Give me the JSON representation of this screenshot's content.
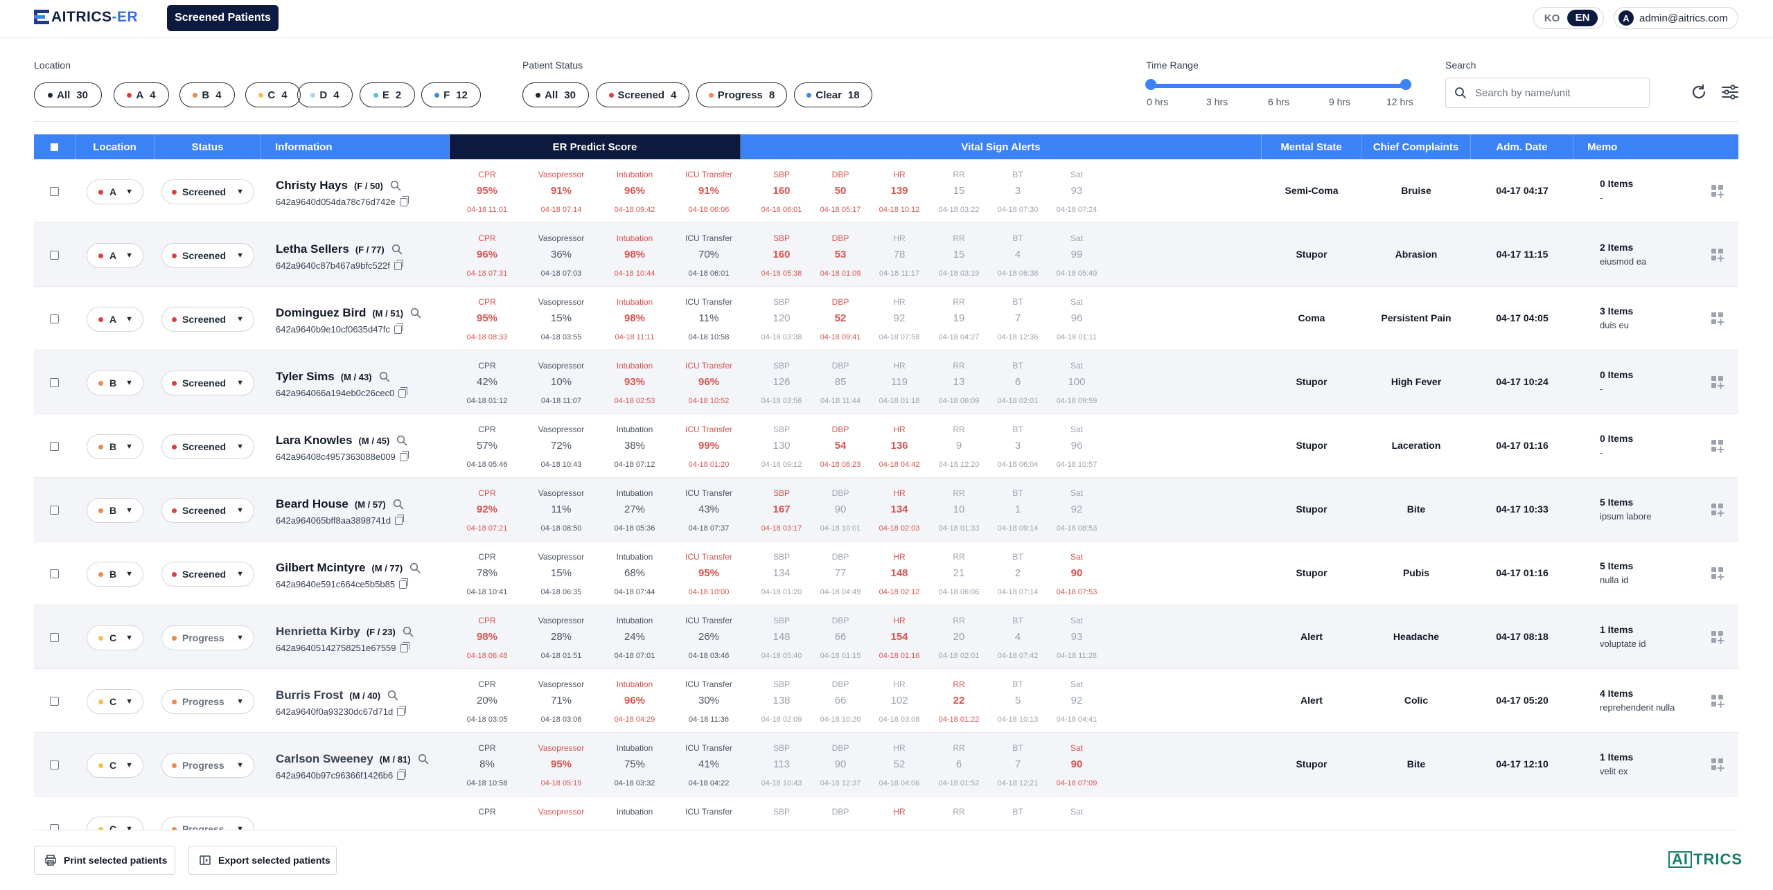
{
  "app": {
    "logo_main": "AITRICS",
    "logo_suffix": "-ER",
    "active_tab": "Screened Patients"
  },
  "lang": {
    "ko": "KO",
    "en": "EN"
  },
  "user": {
    "avatar": "A",
    "email": "admin@aitrics.com"
  },
  "filters": {
    "location_label": "Location",
    "locations": [
      {
        "label": "All",
        "count": "30",
        "color": "#1f2937"
      },
      {
        "label": "A",
        "count": "4",
        "color": "#e03e3e"
      },
      {
        "label": "B",
        "count": "4",
        "color": "#f08a4b"
      },
      {
        "label": "C",
        "count": "4",
        "color": "#f2c14e"
      },
      {
        "label": "D",
        "count": "4",
        "color": "#a8d5f2"
      },
      {
        "label": "E",
        "count": "2",
        "color": "#5bc0de"
      },
      {
        "label": "F",
        "count": "12",
        "color": "#3a8dde"
      }
    ],
    "status_label": "Patient Status",
    "statuses": [
      {
        "label": "All",
        "count": "30",
        "color": "#1f2937"
      },
      {
        "label": "Screened",
        "count": "4",
        "color": "#e03e3e"
      },
      {
        "label": "Progress",
        "count": "8",
        "color": "#f08a4b"
      },
      {
        "label": "Clear",
        "count": "18",
        "color": "#3a8dde"
      }
    ],
    "time_label": "Time Range",
    "time_ticks": [
      "0 hrs",
      "3 hrs",
      "6 hrs",
      "9 hrs",
      "12 hrs"
    ],
    "time_range_hrs": [
      0,
      12
    ],
    "search_label": "Search",
    "search_placeholder": "Search by name/unit"
  },
  "table": {
    "headers": {
      "location": "Location",
      "status": "Status",
      "information": "Information",
      "er_predict": "ER Predict Score",
      "vital": "Vital Sign Alerts",
      "mental": "Mental State",
      "chief": "Chief Complaints",
      "adm": "Adm. Date",
      "memo": "Memo"
    },
    "score_labels": [
      "CPR",
      "Vasopressor",
      "Intubation",
      "ICU Transfer"
    ],
    "vital_labels": [
      "SBP",
      "DBP",
      "HR",
      "RR",
      "BT",
      "Sat"
    ],
    "rows": [
      {
        "loc": "A",
        "loc_color": "#e03e3e",
        "status": "Screened",
        "status_color": "#e03e3e",
        "name": "Christy Hays",
        "sexage": "(F / 50)",
        "id": "642a9640d054da78c76d742e",
        "scores": [
          [
            "95%",
            "04-18 11:01",
            1
          ],
          [
            "91%",
            "04-18 07:14",
            1
          ],
          [
            "96%",
            "04-18 09:42",
            1
          ],
          [
            "91%",
            "04-18 06:06",
            1
          ]
        ],
        "vitals": [
          [
            "160",
            "04-18 06:01",
            1
          ],
          [
            "50",
            "04-18 05:17",
            1
          ],
          [
            "139",
            "04-18 10:12",
            1
          ],
          [
            "15",
            "04-18 03:22",
            0
          ],
          [
            "3",
            "04-18 07:30",
            0
          ],
          [
            "93",
            "04-18 07:24",
            0
          ]
        ],
        "mental": "Semi-Coma",
        "chief": "Bruise",
        "adm": "04-17 04:17",
        "memo_count": "0 Items",
        "memo_text": "-"
      },
      {
        "loc": "A",
        "loc_color": "#e03e3e",
        "status": "Screened",
        "status_color": "#e03e3e",
        "name": "Letha Sellers",
        "sexage": "(F / 77)",
        "id": "642a9640c87b467a9bfc522f",
        "scores": [
          [
            "96%",
            "04-18 07:31",
            1
          ],
          [
            "36%",
            "04-18 07:03",
            0
          ],
          [
            "98%",
            "04-18 10:44",
            1
          ],
          [
            "70%",
            "04-18 06:01",
            0
          ]
        ],
        "vitals": [
          [
            "160",
            "04-18 05:38",
            1
          ],
          [
            "53",
            "04-18 01:09",
            1
          ],
          [
            "78",
            "04-18 11:17",
            0
          ],
          [
            "15",
            "04-18 03:19",
            0
          ],
          [
            "4",
            "04-18 06:38",
            0
          ],
          [
            "99",
            "04-18 05:49",
            0
          ]
        ],
        "mental": "Stupor",
        "chief": "Abrasion",
        "adm": "04-17 11:15",
        "memo_count": "2 Items",
        "memo_text": "eiusmod ea"
      },
      {
        "loc": "A",
        "loc_color": "#e03e3e",
        "status": "Screened",
        "status_color": "#e03e3e",
        "name": "Dominguez Bird",
        "sexage": "(M / 51)",
        "id": "642a9640b9e10cf0635d47fc",
        "scores": [
          [
            "95%",
            "04-18 08:33",
            1
          ],
          [
            "15%",
            "04-18 03:55",
            0
          ],
          [
            "98%",
            "04-18 11:11",
            1
          ],
          [
            "11%",
            "04-18 10:58",
            0
          ]
        ],
        "vitals": [
          [
            "120",
            "04-18 03:38",
            0
          ],
          [
            "52",
            "04-18 09:41",
            1
          ],
          [
            "92",
            "04-18 07:58",
            0
          ],
          [
            "19",
            "04-18 04:27",
            0
          ],
          [
            "7",
            "04-18 12:36",
            0
          ],
          [
            "96",
            "04-18 01:11",
            0
          ]
        ],
        "mental": "Coma",
        "chief": "Persistent Pain",
        "adm": "04-17 04:05",
        "memo_count": "3 Items",
        "memo_text": "duis eu"
      },
      {
        "loc": "B",
        "loc_color": "#f08a4b",
        "status": "Screened",
        "status_color": "#e03e3e",
        "name": "Tyler Sims",
        "sexage": "(M / 43)",
        "id": "642a964066a194eb0c26cec0",
        "scores": [
          [
            "42%",
            "04-18 01:12",
            0
          ],
          [
            "10%",
            "04-18 11:07",
            0
          ],
          [
            "93%",
            "04-18 02:53",
            1
          ],
          [
            "96%",
            "04-18 10:52",
            1
          ]
        ],
        "vitals": [
          [
            "126",
            "04-18 03:56",
            0
          ],
          [
            "85",
            "04-18 11:44",
            0
          ],
          [
            "119",
            "04-18 01:18",
            0
          ],
          [
            "13",
            "04-18 06:09",
            0
          ],
          [
            "6",
            "04-18 02:01",
            0
          ],
          [
            "100",
            "04-18 09:59",
            0
          ]
        ],
        "mental": "Stupor",
        "chief": "High Fever",
        "adm": "04-17 10:24",
        "memo_count": "0 Items",
        "memo_text": "-"
      },
      {
        "loc": "B",
        "loc_color": "#f08a4b",
        "status": "Screened",
        "status_color": "#e03e3e",
        "name": "Lara Knowles",
        "sexage": "(M / 45)",
        "id": "642a96408c4957363088e009",
        "scores": [
          [
            "57%",
            "04-18 05:46",
            0
          ],
          [
            "72%",
            "04-18 10:43",
            0
          ],
          [
            "38%",
            "04-18 07:12",
            0
          ],
          [
            "99%",
            "04-18 01:20",
            1
          ]
        ],
        "vitals": [
          [
            "130",
            "04-18 09:12",
            0
          ],
          [
            "54",
            "04-18 08:23",
            1
          ],
          [
            "136",
            "04-18 04:42",
            1
          ],
          [
            "9",
            "04-18 12:20",
            0
          ],
          [
            "3",
            "04-18 06:04",
            0
          ],
          [
            "96",
            "04-18 10:57",
            0
          ]
        ],
        "mental": "Stupor",
        "chief": "Laceration",
        "adm": "04-17 01:16",
        "memo_count": "0 Items",
        "memo_text": "-"
      },
      {
        "loc": "B",
        "loc_color": "#f08a4b",
        "status": "Screened",
        "status_color": "#e03e3e",
        "name": "Beard House",
        "sexage": "(M / 57)",
        "id": "642a964065bff8aa3898741d",
        "scores": [
          [
            "92%",
            "04-18 07:21",
            1
          ],
          [
            "11%",
            "04-18 08:50",
            0
          ],
          [
            "27%",
            "04-18 05:36",
            0
          ],
          [
            "43%",
            "04-18 07:37",
            0
          ]
        ],
        "vitals": [
          [
            "167",
            "04-18 03:17",
            1
          ],
          [
            "90",
            "04-18 10:01",
            0
          ],
          [
            "134",
            "04-18 02:03",
            1
          ],
          [
            "10",
            "04-18 01:33",
            0
          ],
          [
            "1",
            "04-18 09:14",
            0
          ],
          [
            "92",
            "04-18 08:53",
            0
          ]
        ],
        "mental": "Stupor",
        "chief": "Bite",
        "adm": "04-17 10:33",
        "memo_count": "5 Items",
        "memo_text": "ipsum labore"
      },
      {
        "loc": "B",
        "loc_color": "#f08a4b",
        "status": "Screened",
        "status_color": "#e03e3e",
        "name": "Gilbert Mcintyre",
        "sexage": "(M / 77)",
        "id": "642a9640e591c664ce5b5b85",
        "scores": [
          [
            "78%",
            "04-18 10:41",
            0
          ],
          [
            "15%",
            "04-18 06:35",
            0
          ],
          [
            "68%",
            "04-18 07:44",
            0
          ],
          [
            "95%",
            "04-18 10:00",
            1
          ]
        ],
        "vitals": [
          [
            "134",
            "04-18 01:20",
            0
          ],
          [
            "77",
            "04-18 04:49",
            0
          ],
          [
            "148",
            "04-18 02:12",
            1
          ],
          [
            "21",
            "04-18 06:06",
            0
          ],
          [
            "2",
            "04-18 07:14",
            0
          ],
          [
            "90",
            "04-18 07:53",
            1
          ]
        ],
        "mental": "Stupor",
        "chief": "Pubis",
        "adm": "04-17 01:16",
        "memo_count": "5 Items",
        "memo_text": "nulla id"
      },
      {
        "loc": "C",
        "loc_color": "#f2c14e",
        "status": "Progress",
        "status_color": "#f08a4b",
        "name": "Henrietta Kirby",
        "sexage": "(F / 23)",
        "id": "642a96405142758251e67559",
        "scores": [
          [
            "98%",
            "04-18 06:48",
            1
          ],
          [
            "28%",
            "04-18 01:51",
            0
          ],
          [
            "24%",
            "04-18 07:01",
            0
          ],
          [
            "26%",
            "04-18 03:46",
            0
          ]
        ],
        "vitals": [
          [
            "148",
            "04-18 05:40",
            0
          ],
          [
            "66",
            "04-18 01:15",
            0
          ],
          [
            "154",
            "04-18 01:16",
            1
          ],
          [
            "20",
            "04-18 02:01",
            0
          ],
          [
            "4",
            "04-18 07:42",
            0
          ],
          [
            "93",
            "04-18 11:28",
            0
          ]
        ],
        "mental": "Alert",
        "chief": "Headache",
        "adm": "04-17 08:18",
        "memo_count": "1 Items",
        "memo_text": "voluptate id"
      },
      {
        "loc": "C",
        "loc_color": "#f2c14e",
        "status": "Progress",
        "status_color": "#f08a4b",
        "name": "Burris Frost",
        "sexage": "(M / 40)",
        "id": "642a9640f0a93230dc67d71d",
        "scores": [
          [
            "20%",
            "04-18 03:05",
            0
          ],
          [
            "71%",
            "04-18 03:06",
            0
          ],
          [
            "96%",
            "04-18 04:29",
            1
          ],
          [
            "30%",
            "04-18 11:36",
            0
          ]
        ],
        "vitals": [
          [
            "138",
            "04-18 02:09",
            0
          ],
          [
            "66",
            "04-18 10:20",
            0
          ],
          [
            "102",
            "04-18 03:08",
            0
          ],
          [
            "22",
            "04-18 01:22",
            1
          ],
          [
            "5",
            "04-18 10:13",
            0
          ],
          [
            "92",
            "04-18 04:41",
            0
          ]
        ],
        "mental": "Alert",
        "chief": "Colic",
        "adm": "04-17 05:20",
        "memo_count": "4 Items",
        "memo_text": "reprehenderit nulla"
      },
      {
        "loc": "C",
        "loc_color": "#f2c14e",
        "status": "Progress",
        "status_color": "#f08a4b",
        "name": "Carlson Sweeney",
        "sexage": "(M / 81)",
        "id": "642a9640b97c96366f1426b6",
        "scores": [
          [
            "8%",
            "04-18 10:58",
            0
          ],
          [
            "95%",
            "04-18 05:19",
            1
          ],
          [
            "75%",
            "04-18 03:32",
            0
          ],
          [
            "41%",
            "04-18 04:22",
            0
          ]
        ],
        "vitals": [
          [
            "113",
            "04-18 10:43",
            0
          ],
          [
            "90",
            "04-18 12:37",
            0
          ],
          [
            "52",
            "04-18 04:06",
            0
          ],
          [
            "6",
            "04-18 01:52",
            0
          ],
          [
            "7",
            "04-18 12:21",
            0
          ],
          [
            "90",
            "04-18 07:09",
            1
          ]
        ],
        "mental": "Stupor",
        "chief": "Bite",
        "adm": "04-17 12:10",
        "memo_count": "1 Items",
        "memo_text": "velit ex"
      },
      {
        "loc": "C",
        "loc_color": "#f2c14e",
        "status": "Progress",
        "status_color": "#f08a4b",
        "name": "",
        "sexage": "",
        "id": "",
        "scores": [
          [
            "",
            "",
            0
          ],
          [
            "",
            "",
            1
          ],
          [
            "",
            "",
            0
          ],
          [
            "",
            "",
            0
          ]
        ],
        "vitals": [
          [
            "",
            "",
            0
          ],
          [
            "",
            "",
            0
          ],
          [
            "",
            "",
            1
          ],
          [
            "",
            "",
            0
          ],
          [
            "",
            "",
            0
          ],
          [
            "",
            "",
            0
          ]
        ],
        "mental": "",
        "chief": "",
        "adm": "",
        "memo_count": "",
        "memo_text": ""
      }
    ]
  },
  "footer": {
    "print": "Print selected patients",
    "export": "Export selected patients",
    "brand_box": "AI",
    "brand_rest": "TRICS"
  },
  "colors": {
    "accent": "#3b82f6",
    "navy": "#0d1a3f",
    "alert": "#d9534f"
  },
  "icons": [
    "search-icon",
    "refresh-icon",
    "filter-settings-icon",
    "copy-icon",
    "memo-add-icon",
    "print-icon",
    "export-icon",
    "chevron-down-icon",
    "checkbox"
  ]
}
